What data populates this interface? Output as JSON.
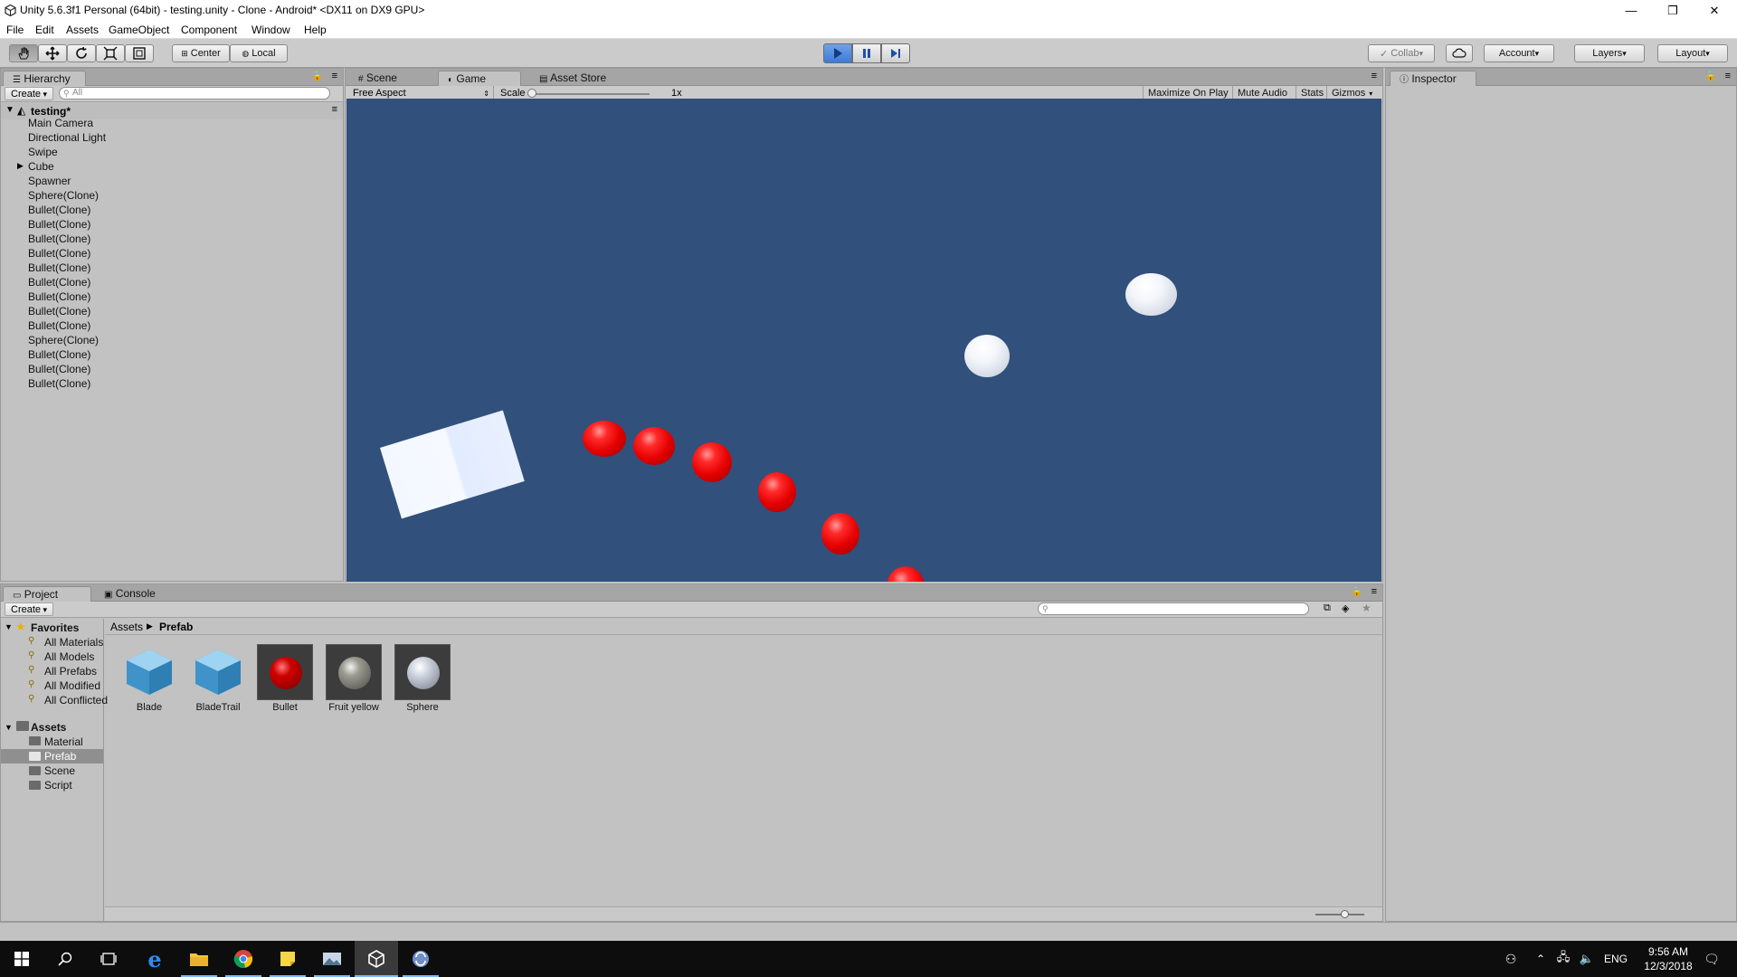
{
  "window": {
    "title": "Unity 5.6.3f1 Personal (64bit) - testing.unity - Clone - Android* <DX11 on DX9 GPU>",
    "controls": [
      "—",
      "❐",
      "✕"
    ]
  },
  "menu": [
    "File",
    "Edit",
    "Assets",
    "GameObject",
    "Component",
    "Window",
    "Help"
  ],
  "toolbar": {
    "pivot_label": "Center",
    "space_label": "Local",
    "collab_label": "Collab",
    "account_label": "Account",
    "layers_label": "Layers",
    "layout_label": "Layout",
    "play_state": "playing",
    "accent": "#3c7bd6"
  },
  "hierarchy": {
    "tab_label": "Hierarchy",
    "create_label": "Create",
    "search_placeholder": "All",
    "scene_name": "testing*",
    "items": [
      "Main Camera",
      "Directional Light",
      "Swipe",
      "Cube",
      "Spawner",
      "Sphere(Clone)",
      "Bullet(Clone)",
      "Bullet(Clone)",
      "Bullet(Clone)",
      "Bullet(Clone)",
      "Bullet(Clone)",
      "Bullet(Clone)",
      "Bullet(Clone)",
      "Bullet(Clone)",
      "Bullet(Clone)",
      "Sphere(Clone)",
      "Bullet(Clone)",
      "Bullet(Clone)",
      "Bullet(Clone)"
    ]
  },
  "center": {
    "tabs": [
      "Scene",
      "Game",
      "Asset Store"
    ],
    "active_tab": "Game",
    "aspect_label": "Free Aspect",
    "scale_label": "Scale",
    "scale_value": "1x",
    "buttons": [
      "Maximize On Play",
      "Mute Audio",
      "Stats",
      "Gizmos"
    ],
    "background_color": "#31507b"
  },
  "inspector": {
    "tab_label": "Inspector"
  },
  "project": {
    "tabs": [
      "Project",
      "Console"
    ],
    "create_label": "Create",
    "breadcrumb": [
      "Assets",
      "Prefab"
    ],
    "favorites_label": "Favorites",
    "favorites": [
      "All Materials",
      "All Models",
      "All Prefabs",
      "All Modified",
      "All Conflicted"
    ],
    "assets_label": "Assets",
    "folders": [
      "Material",
      "Prefab",
      "Scene",
      "Script"
    ],
    "selected_folder": "Prefab",
    "assets": [
      {
        "name": "Blade",
        "kind": "prefab-cube"
      },
      {
        "name": "BladeTrail",
        "kind": "prefab-cube"
      },
      {
        "name": "Bullet",
        "kind": "material-red"
      },
      {
        "name": "Fruit yellow",
        "kind": "material-grey"
      },
      {
        "name": "Sphere",
        "kind": "material-white"
      }
    ]
  },
  "taskbar": {
    "language": "ENG",
    "time": "9:56 AM",
    "date": "12/3/2018"
  }
}
